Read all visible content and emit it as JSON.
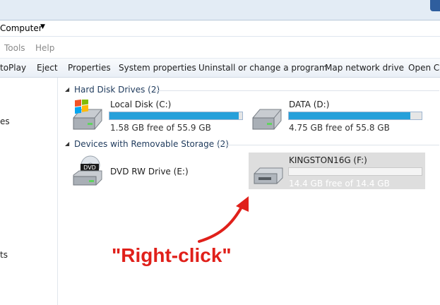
{
  "address": {
    "crumb": "Computer",
    "chevron": "▼"
  },
  "menubar": {
    "items": [
      "Tools",
      "Help"
    ]
  },
  "commandbar": {
    "items": [
      "toPlay",
      "Eject",
      "Properties",
      "System properties",
      "Uninstall or change a program",
      "Map network drive",
      "Open Co"
    ]
  },
  "navpane": {
    "items": [
      "es",
      "ts"
    ]
  },
  "groups": {
    "hdd": {
      "title": "Hard Disk Drives (2)"
    },
    "removable": {
      "title": "Devices with Removable Storage (2)"
    }
  },
  "drives": {
    "c": {
      "name": "Local Disk (C:)",
      "free": "1.58 GB free of 55.9 GB",
      "used_fraction": 0.972,
      "icon": "windows-hard-drive-icon"
    },
    "d": {
      "name": "DATA (D:)",
      "free": "4.75 GB free of 55.8 GB",
      "used_fraction": 0.915,
      "icon": "hard-drive-icon"
    },
    "e": {
      "name": "DVD RW Drive (E:)",
      "icon": "dvd-drive-icon",
      "icon_label": "DVD"
    },
    "f": {
      "name": "KINGSTON16G (F:)",
      "free": "14.4 GB free of 14.4 GB",
      "used_fraction": 0.0,
      "icon": "usb-drive-icon"
    }
  },
  "annotation": {
    "text": "\"Right-click\""
  },
  "colors": {
    "bar_fill": "#26a0da",
    "annotation": "#e0201a",
    "selected_tile": "#dedede"
  }
}
